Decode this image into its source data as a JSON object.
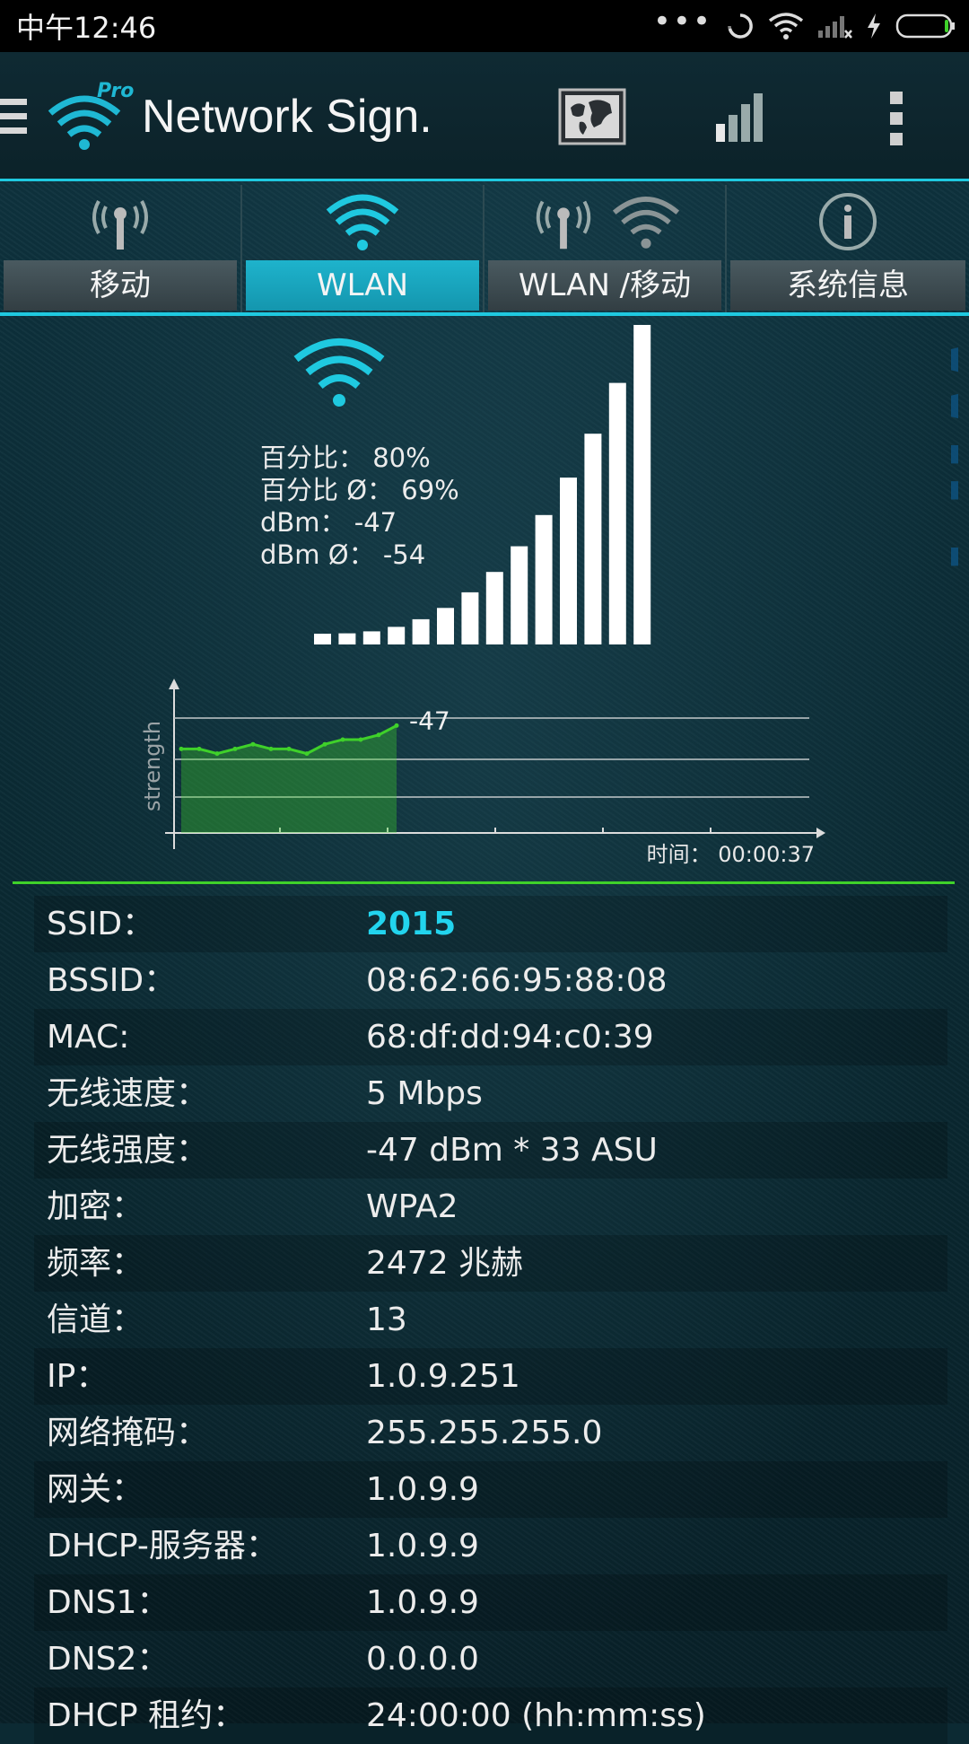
{
  "status_bar": {
    "time": "中午12:46",
    "dots": "•••",
    "icons": [
      "sync-icon",
      "wifi-icon",
      "cell-signal-icon",
      "charging-icon",
      "battery-icon"
    ]
  },
  "app_bar": {
    "title": "Network Sign.",
    "logo_badge": "Pro",
    "actions": [
      "map-icon",
      "signal-bars-icon",
      "overflow-menu-icon"
    ]
  },
  "tabs": [
    {
      "label": "移动",
      "icon": "cell-tower-icon",
      "active": false
    },
    {
      "label": "WLAN",
      "icon": "wifi-icon",
      "active": true
    },
    {
      "label": "WLAN /移动",
      "icon": "tower-and-wifi-icon",
      "active": false
    },
    {
      "label": "系统信息",
      "icon": "info-icon",
      "active": false
    }
  ],
  "signal": {
    "percent": "百分比： 80%",
    "percent_avg": "百分比 Ø： 69%",
    "dbm": "dBm： -47",
    "dbm_avg": "dBm Ø： -54",
    "watermark": "WIFI",
    "bars_count": 14,
    "bars_lit": 14
  },
  "chart_data": {
    "type": "line",
    "ylabel": "strength",
    "current_value_label": "-47",
    "time_label": "时间： 00:00:37",
    "series": [
      {
        "values": [
          -52,
          -52,
          -53,
          -52,
          -51,
          -52,
          -52,
          -53,
          -51,
          -50,
          -50,
          -49,
          -47
        ]
      }
    ],
    "grid": true,
    "color": "#3fd12a"
  },
  "info_rows": [
    {
      "key": "SSID：",
      "value": "2015",
      "highlight": true
    },
    {
      "key": "BSSID：",
      "value": "08:62:66:95:88:08"
    },
    {
      "key": "MAC:",
      "value": "68:df:dd:94:c0:39"
    },
    {
      "key": "无线速度：",
      "value": "5 Mbps"
    },
    {
      "key": "无线强度：",
      "value": "-47 dBm * 33 ASU"
    },
    {
      "key": "加密：",
      "value": "WPA2"
    },
    {
      "key": "频率：",
      "value": "2472 兆赫"
    },
    {
      "key": "信道：",
      "value": "13"
    },
    {
      "key": "IP：",
      "value": "1.0.9.251"
    },
    {
      "key": "网络掩码：",
      "value": "255.255.255.0"
    },
    {
      "key": "网关：",
      "value": "1.0.9.9"
    },
    {
      "key": "DHCP-服务器：",
      "value": "1.0.9.9"
    },
    {
      "key": "DNS1：",
      "value": "1.0.9.9"
    },
    {
      "key": "DNS2：",
      "value": "0.0.0.0"
    },
    {
      "key": "DHCP 租约：",
      "value": "24:00:00 (hh:mm:ss)"
    }
  ],
  "colors": {
    "accent": "#1fc9e0",
    "active_tab": "#1ba8c0",
    "graph_green": "#3fd12a",
    "watermark_blue": "#0e4f7a"
  }
}
